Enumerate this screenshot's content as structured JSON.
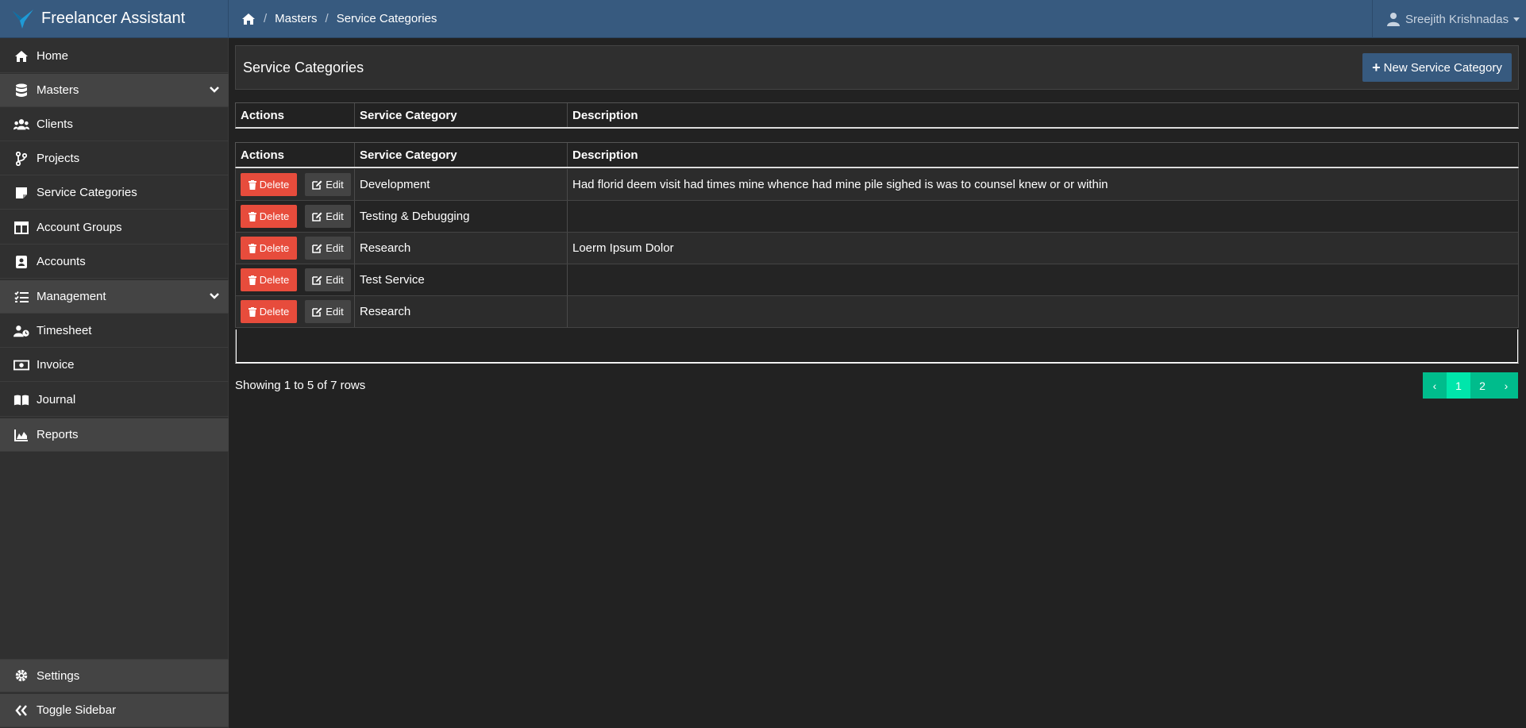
{
  "app": {
    "title": "Freelancer Assistant"
  },
  "breadcrumb": {
    "items": [
      "Masters",
      "Service Categories"
    ]
  },
  "user": {
    "name": "Sreejith Krishnadas"
  },
  "sidebar": {
    "items": [
      {
        "label": "Home",
        "icon": "home-icon"
      },
      {
        "label": "Masters",
        "icon": "database-icon",
        "group": true
      },
      {
        "label": "Clients",
        "icon": "users-icon"
      },
      {
        "label": "Projects",
        "icon": "code-branch-icon"
      },
      {
        "label": "Service Categories",
        "icon": "sticky-note-icon"
      },
      {
        "label": "Account Groups",
        "icon": "columns-icon"
      },
      {
        "label": "Accounts",
        "icon": "address-book-icon"
      },
      {
        "label": "Management",
        "icon": "tasks-icon",
        "group": true
      },
      {
        "label": "Timesheet",
        "icon": "user-clock-icon"
      },
      {
        "label": "Invoice",
        "icon": "money-bill-icon"
      },
      {
        "label": "Journal",
        "icon": "book-open-icon"
      },
      {
        "label": "Reports",
        "icon": "chart-area-icon",
        "group": true
      },
      {
        "label": "Settings",
        "icon": "gear-icon"
      },
      {
        "label": "Toggle Sidebar",
        "icon": "double-chevron-left-icon"
      }
    ]
  },
  "page": {
    "title": "Service Categories",
    "new_button": "New Service Category"
  },
  "table": {
    "headers": [
      "Actions",
      "Service Category",
      "Description"
    ],
    "delete_label": "Delete",
    "edit_label": "Edit",
    "rows": [
      {
        "category": "Development",
        "description": "Had florid deem visit had times mine whence had mine pile sighed is was to counsel knew or or within"
      },
      {
        "category": "Testing & Debugging",
        "description": ""
      },
      {
        "category": "Research",
        "description": "Loerm Ipsum Dolor"
      },
      {
        "category": "Test Service",
        "description": ""
      },
      {
        "category": "Research",
        "description": ""
      }
    ]
  },
  "pagination": {
    "summary": "Showing 1 to 5 of 7 rows",
    "prev": "‹",
    "pages": [
      "1",
      "2"
    ],
    "next": "›",
    "active_page": "1"
  },
  "colors": {
    "navbar": "#375a7f",
    "delete": "#e74c3c",
    "pager": "#00bc8c",
    "background": "#222222"
  }
}
